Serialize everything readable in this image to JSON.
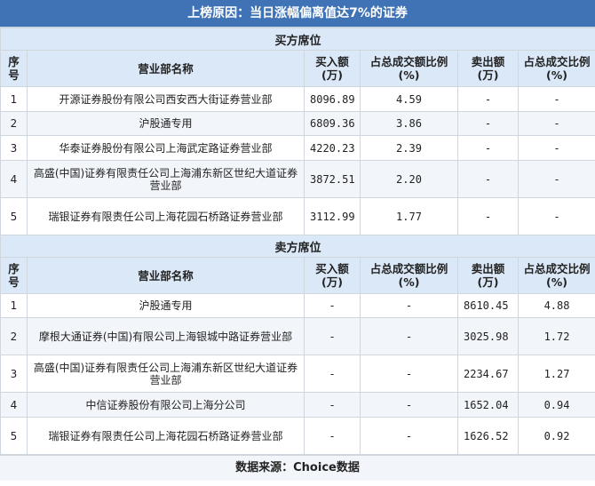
{
  "title": "上榜原因：当日涨幅偏离值达7%的证券",
  "columns": {
    "idx": "序号",
    "name": "营业部名称",
    "buy": "买入额(万)",
    "buy_pct": "占总成交额比例(%)",
    "sell": "卖出额(万)",
    "sell_pct": "占总成交比例(%)"
  },
  "buy_section": {
    "label": "买方席位",
    "rows": [
      {
        "idx": "1",
        "name": "开源证券股份有限公司西安西大街证券营业部",
        "buy": "8096.89",
        "buy_pct": "4.59",
        "sell": "-",
        "sell_pct": "-"
      },
      {
        "idx": "2",
        "name": "沪股通专用",
        "buy": "6809.36",
        "buy_pct": "3.86",
        "sell": "-",
        "sell_pct": "-"
      },
      {
        "idx": "3",
        "name": "华泰证券股份有限公司上海武定路证券营业部",
        "buy": "4220.23",
        "buy_pct": "2.39",
        "sell": "-",
        "sell_pct": "-"
      },
      {
        "idx": "4",
        "name": "高盛(中国)证券有限责任公司上海浦东新区世纪大道证券营业部",
        "buy": "3872.51",
        "buy_pct": "2.20",
        "sell": "-",
        "sell_pct": "-"
      },
      {
        "idx": "5",
        "name": "瑞银证券有限责任公司上海花园石桥路证券营业部",
        "buy": "3112.99",
        "buy_pct": "1.77",
        "sell": "-",
        "sell_pct": "-"
      }
    ]
  },
  "sell_section": {
    "label": "卖方席位",
    "rows": [
      {
        "idx": "1",
        "name": "沪股通专用",
        "buy": "-",
        "buy_pct": "-",
        "sell": "8610.45",
        "sell_pct": "4.88"
      },
      {
        "idx": "2",
        "name": "摩根大通证券(中国)有限公司上海银城中路证券营业部",
        "buy": "-",
        "buy_pct": "-",
        "sell": "3025.98",
        "sell_pct": "1.72"
      },
      {
        "idx": "3",
        "name": "高盛(中国)证券有限责任公司上海浦东新区世纪大道证券营业部",
        "buy": "-",
        "buy_pct": "-",
        "sell": "2234.67",
        "sell_pct": "1.27"
      },
      {
        "idx": "4",
        "name": "中信证券股份有限公司上海分公司",
        "buy": "-",
        "buy_pct": "-",
        "sell": "1652.04",
        "sell_pct": "0.94"
      },
      {
        "idx": "5",
        "name": "瑞银证券有限责任公司上海花园石桥路证券营业部",
        "buy": "-",
        "buy_pct": "-",
        "sell": "1626.52",
        "sell_pct": "0.92"
      }
    ]
  },
  "footer": "数据来源：Choice数据"
}
